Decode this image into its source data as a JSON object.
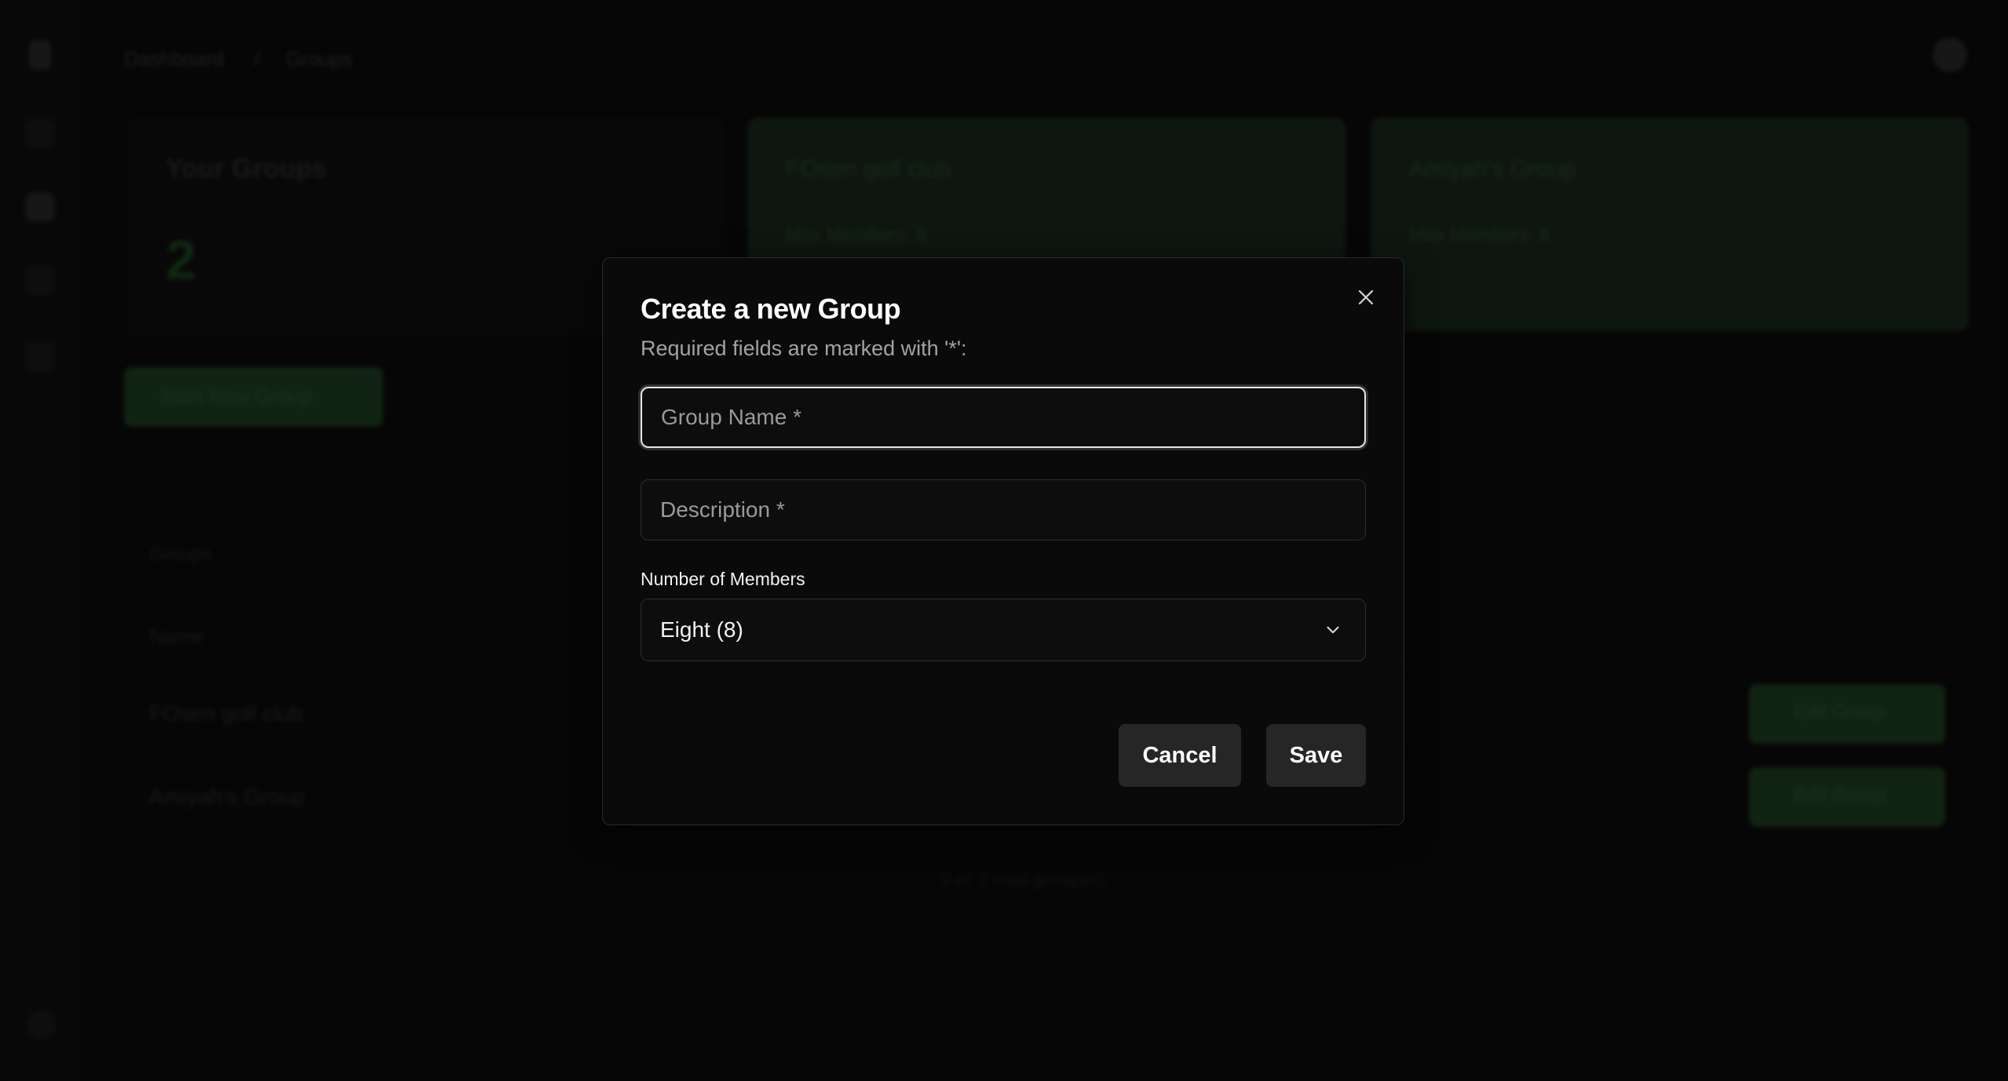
{
  "background": {
    "breadcrumb": [
      "Dashboard",
      "/",
      "Groups"
    ],
    "stat_card": {
      "title": "Your Groups",
      "value": "2"
    },
    "group_cards": [
      {
        "title": "FOsen golf club",
        "subtitle": "Max Members: 8"
      },
      {
        "title": "Amiyah's Group",
        "subtitle": "Max Members: 8"
      }
    ],
    "start_button_label": "Start New Group",
    "tab_label": "Groups",
    "table_header": "Name",
    "rows": [
      "FOsen golf club",
      "Amiyah's Group"
    ],
    "edit_button_label": "Edit Group",
    "footer": "0 of 2 total group(s)."
  },
  "modal": {
    "title": "Create a new Group",
    "subtitle": "Required fields are marked with '*':",
    "group_name_placeholder": "Group Name *",
    "description_placeholder": "Description *",
    "members_label": "Number of Members",
    "members_value": "Eight (8)",
    "cancel_label": "Cancel",
    "save_label": "Save"
  },
  "icons": {
    "close": "close-icon",
    "chevron": "chevron-down-icon"
  },
  "colors": {
    "background": "#0b0b0b",
    "modal_bg": "#0a0a0a",
    "accent_green": "#1f4223",
    "button_bg": "#262626",
    "text_primary": "#ffffff",
    "text_muted": "#a3a3a3"
  }
}
